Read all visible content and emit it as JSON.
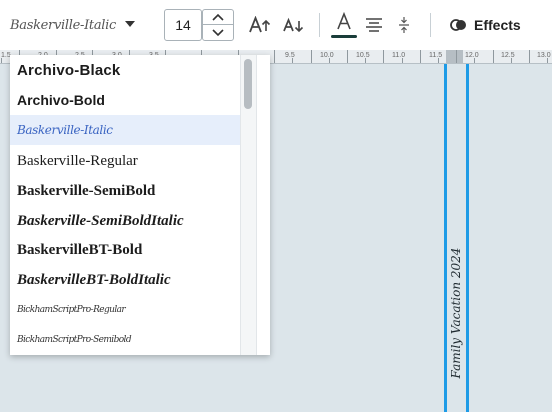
{
  "toolbar": {
    "font_value": "Baskerville-Italic",
    "font_size": "14",
    "effects_label": "Effects",
    "text_color": "#1a3d3a"
  },
  "ruler": {
    "labels": [
      "1.5",
      "2.0",
      "2.5",
      "3.0",
      "3.5",
      "9.5",
      "10.0",
      "10.5",
      "11.0",
      "11.5",
      "12.0",
      "12.5",
      "13.0"
    ]
  },
  "font_list": {
    "items": [
      "Archivo-Black",
      "Archivo-Bold",
      "Baskerville-Italic",
      "Baskerville-Regular",
      "Baskerville-SemiBold",
      "Baskerville-SemiBoldItalic",
      "BaskervilleBT-Bold",
      "BaskervilleBT-BoldItalic",
      "BickhamScriptPro-Regular",
      "BickhamScriptPro-Semibold"
    ],
    "selected": "Baskerville-Italic"
  },
  "canvas": {
    "spine_text": "Family Vacation 2024",
    "spine_color": "#1e9be6"
  }
}
